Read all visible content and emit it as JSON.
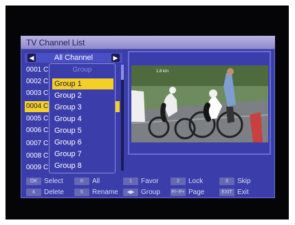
{
  "window": {
    "title": "TV Channel List"
  },
  "channel_list": {
    "header": "All Channel",
    "rows": [
      {
        "number": "0001",
        "initial": "C"
      },
      {
        "number": "0002",
        "initial": "C"
      },
      {
        "number": "0003",
        "initial": "C"
      },
      {
        "number": "0004",
        "initial": "C",
        "selected": true
      },
      {
        "number": "0005",
        "initial": "C"
      },
      {
        "number": "0006",
        "initial": "C"
      },
      {
        "number": "0007",
        "initial": "C"
      },
      {
        "number": "0008",
        "initial": "C"
      },
      {
        "number": "0009",
        "initial": "C"
      }
    ]
  },
  "group_popup": {
    "title": "Group",
    "items": [
      "Group 1",
      "Group 2",
      "Group 3",
      "Group 4",
      "Group 5",
      "Group 6",
      "Group 7",
      "Group 8"
    ],
    "selected_index": 0
  },
  "preview": {
    "icon": "video-preview-cycling",
    "caption": "1.8 km"
  },
  "help_bar": {
    "row1": [
      {
        "key": "OK",
        "label": "Select"
      },
      {
        "key": "0",
        "label": "All"
      },
      {
        "key": "1",
        "label": "Favor"
      },
      {
        "key": "2",
        "label": "Lock"
      },
      {
        "key": "3",
        "label": "Skip"
      }
    ],
    "row2": [
      {
        "key": "4",
        "label": "Delete"
      },
      {
        "key": "5",
        "label": "Rename"
      },
      {
        "key": "◀▶",
        "label": "Group"
      },
      {
        "key": "P/−P+",
        "label": "Page"
      },
      {
        "key": "EXIT",
        "label": "Exit"
      }
    ]
  },
  "colors": {
    "panel": "#3b3daa",
    "highlight": "#f3cf27",
    "title_bar": "#b0abe0",
    "background": "#050507"
  }
}
